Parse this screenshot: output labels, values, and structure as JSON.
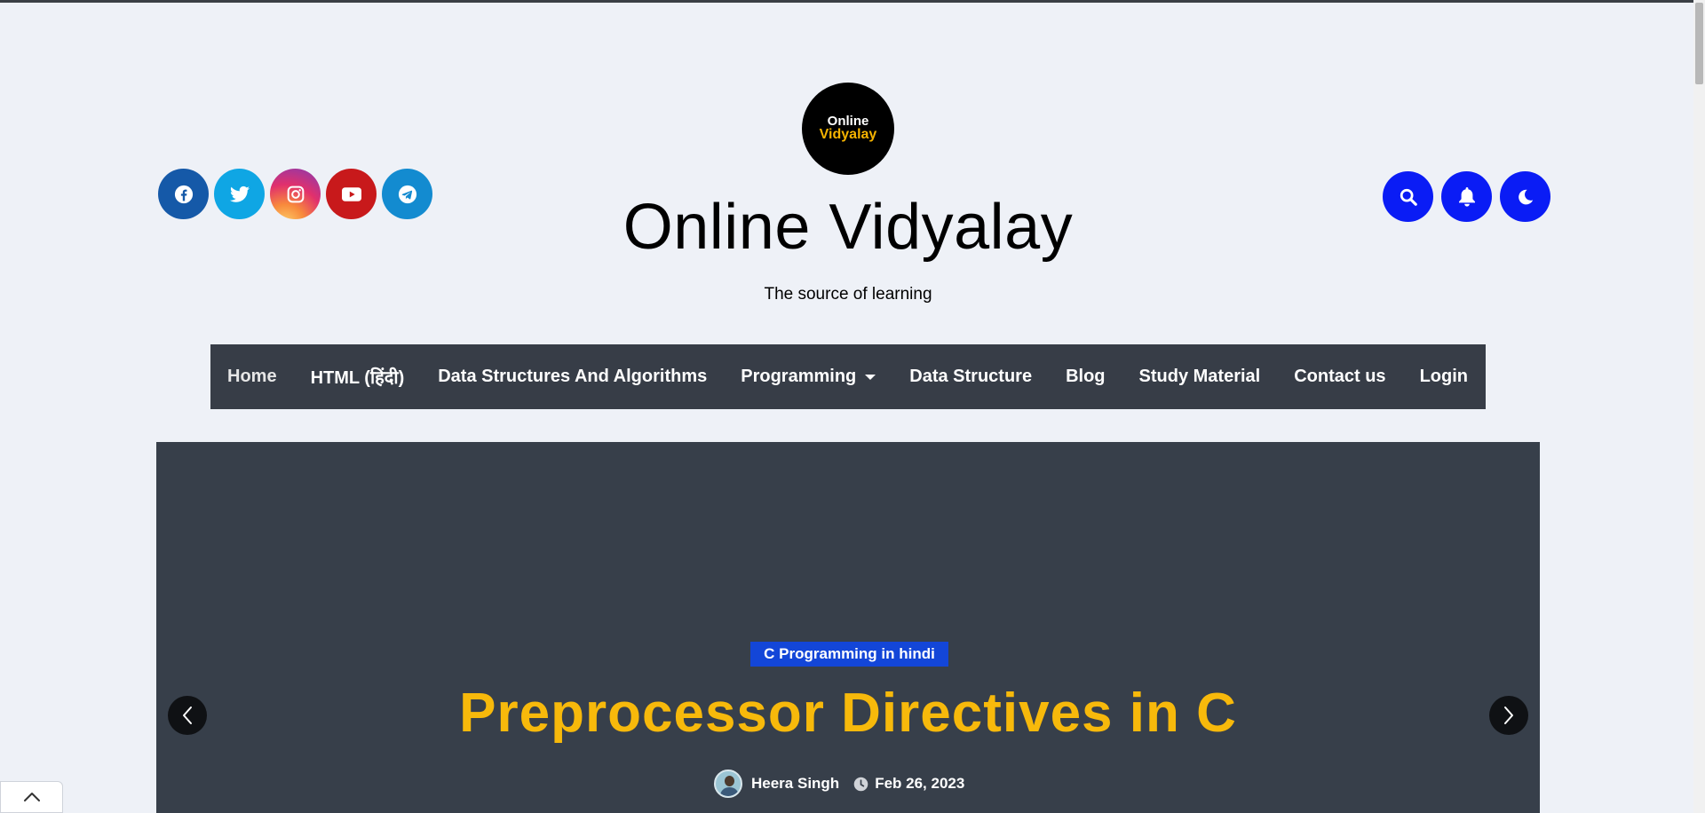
{
  "header": {
    "logo": {
      "line1": "Online",
      "line2": "Vidyalay"
    },
    "site_title": "Online Vidyalay",
    "tagline": "The source of learning",
    "social_icons": [
      "facebook-icon",
      "twitter-icon",
      "instagram-icon",
      "youtube-icon",
      "telegram-icon"
    ],
    "action_icons": [
      "search-icon",
      "bell-icon",
      "moon-icon"
    ]
  },
  "nav": {
    "items": [
      {
        "label": "Home",
        "active": true
      },
      {
        "label": "HTML (हिंदी)"
      },
      {
        "label": "Data Structures And Algorithms"
      },
      {
        "label": "Programming",
        "dropdown": true
      },
      {
        "label": "Data Structure"
      },
      {
        "label": "Blog"
      },
      {
        "label": "Study Material"
      },
      {
        "label": "Contact us"
      },
      {
        "label": "Login"
      }
    ]
  },
  "hero": {
    "category": "C Programming in hindi",
    "title": "Preprocessor Directives in C",
    "author": "Heera Singh",
    "date": "Feb 26, 2023"
  },
  "colors": {
    "background": "#eef1f7",
    "nav_bg": "#373d47",
    "hero_bg": "#373f4a",
    "accent_blue": "#0a1cf5",
    "headline_yellow": "#f7b90b",
    "badge_blue": "#1346d8"
  }
}
